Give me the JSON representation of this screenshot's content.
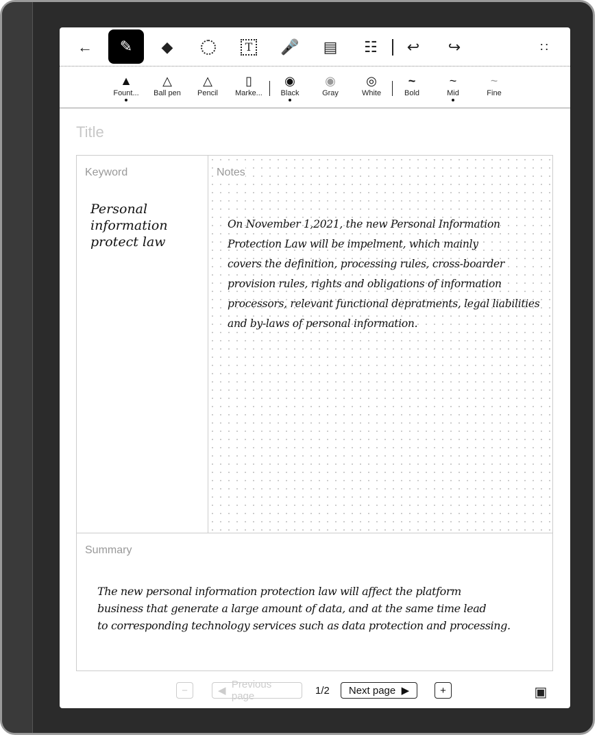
{
  "toolbar": {
    "icons": [
      "back-arrow-icon",
      "pen-icon",
      "eraser-icon",
      "lasso-icon",
      "text-box-icon",
      "microphone-icon",
      "image-icon",
      "template-icon",
      "undo-icon",
      "redo-icon",
      "more-icon"
    ]
  },
  "pens": [
    {
      "label": "Fount...",
      "selected": true
    },
    {
      "label": "Ball pen"
    },
    {
      "label": "Pencil"
    },
    {
      "label": "Marke..."
    }
  ],
  "colors": [
    {
      "label": "Black",
      "selected": true,
      "hex": "#000000"
    },
    {
      "label": "Gray",
      "hex": "#999999"
    },
    {
      "label": "White",
      "hex": "#ffffff"
    }
  ],
  "widths": [
    {
      "label": "Bold"
    },
    {
      "label": "Mid",
      "selected": true
    },
    {
      "label": "Fine"
    }
  ],
  "page": {
    "title_placeholder": "Title",
    "keyword_label": "Keyword",
    "notes_label": "Notes",
    "summary_label": "Summary",
    "keyword_text": "Personal\ninformation\nprotect law",
    "notes_text": "On November 1,2021, the new Personal Information\nProtection Law will be impelment, which mainly\ncovers the definition, processing rules, cross-boarder\nprovision rules, rights and obligations of information\nprocessors, relevant functional depratments, legal liabilities\nand by-laws of personal information.",
    "summary_text": "The new personal information protection law will affect the platform\nbusiness that generate a large amount of data, and at the same time lead\nto corresponding technology services such as data protection and processing."
  },
  "footer": {
    "prev_label": "Previous page",
    "page_indicator": "1/2",
    "next_label": "Next page"
  }
}
